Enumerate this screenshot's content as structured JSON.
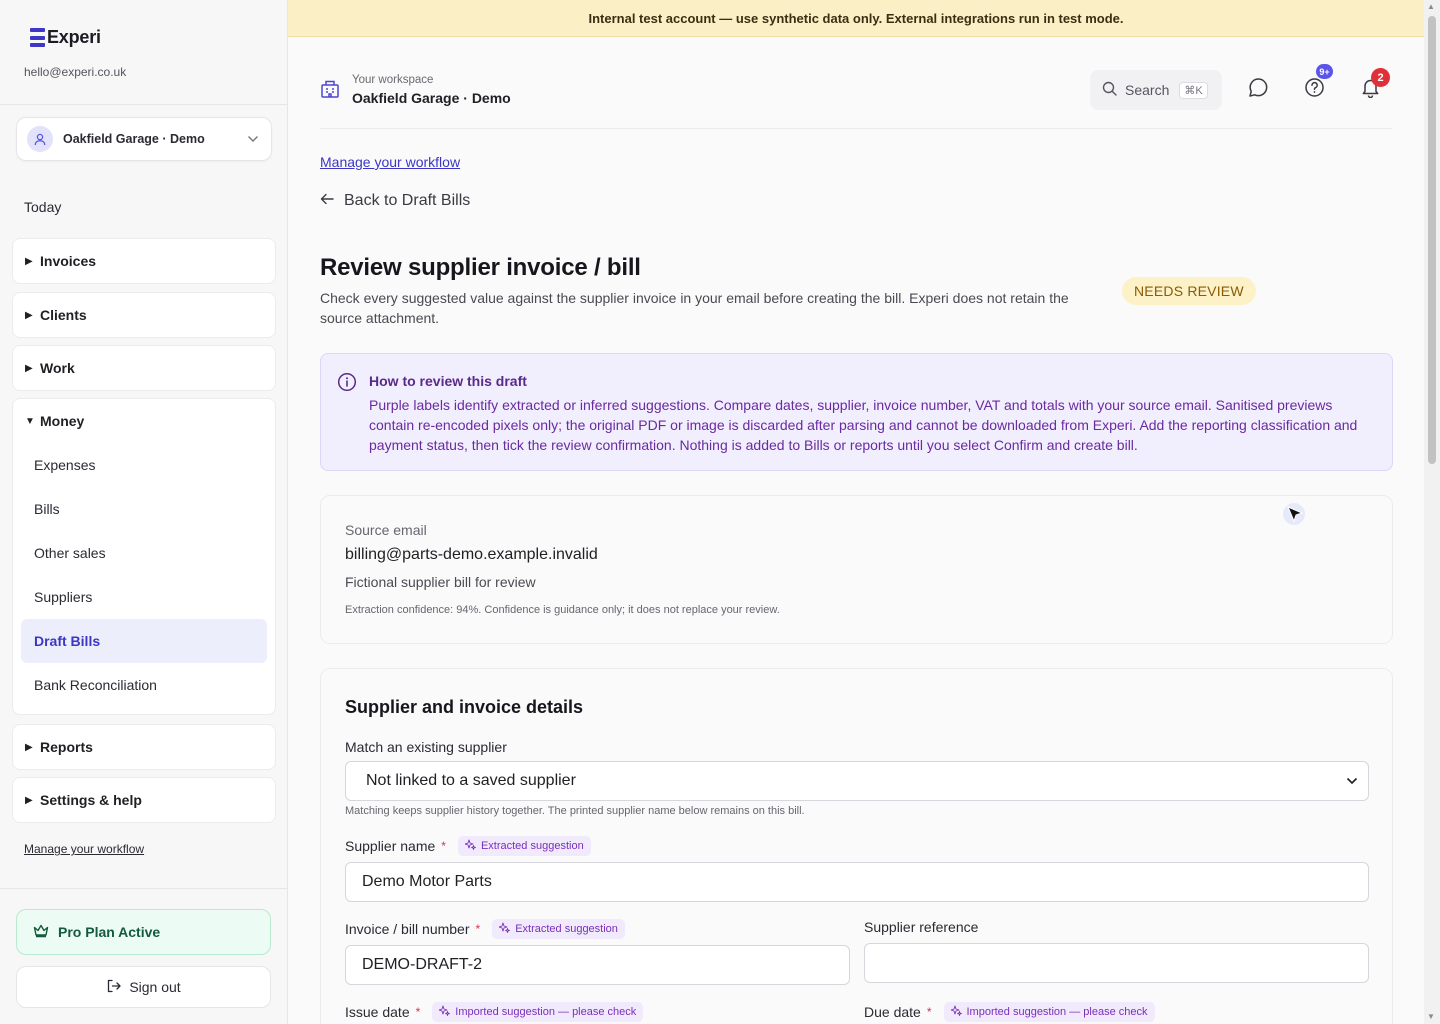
{
  "app": {
    "brand": "Experi",
    "account_email": "hello@experi.co.uk",
    "banner": "Internal test account — use synthetic data only. External integrations run in test mode."
  },
  "sidebar": {
    "workspace_select": "Oakfield Garage · Demo",
    "today": "Today",
    "groups": [
      {
        "label": "Invoices",
        "expanded": false
      },
      {
        "label": "Clients",
        "expanded": false
      },
      {
        "label": "Work",
        "expanded": false
      },
      {
        "label": "Money",
        "expanded": true,
        "items": [
          "Expenses",
          "Bills",
          "Other sales",
          "Suppliers",
          "Draft Bills",
          "Bank Reconciliation"
        ],
        "active": "Draft Bills"
      },
      {
        "label": "Reports",
        "expanded": false
      },
      {
        "label": "Settings & help",
        "expanded": false
      }
    ],
    "manage_link": "Manage your workflow",
    "plan": "Pro Plan Active",
    "sign_out": "Sign out"
  },
  "topbar": {
    "workspace_caption": "Your workspace",
    "workspace_name": "Oakfield Garage · Demo",
    "search_label": "Search",
    "search_shortcut": "⌘K",
    "help_badge": "9+",
    "notification_badge": "2"
  },
  "page": {
    "manage_link": "Manage your workflow",
    "back_link": "Back to Draft Bills",
    "title": "Review supplier invoice / bill",
    "description": "Check every suggested value against the supplier invoice in your email before creating the bill. Experi does not retain the source attachment.",
    "status": "NEEDS REVIEW"
  },
  "info": {
    "title": "How to review this draft",
    "text": "Purple labels identify extracted or inferred suggestions. Compare dates, supplier, invoice number, VAT and totals with your source email. Sanitised previews contain re-encoded pixels only; the original PDF or image is discarded after parsing and cannot be downloaded from Experi. Add the reporting classification and payment status, then tick the review confirmation. Nothing is added to Bills or reports until you select Confirm and create bill."
  },
  "source": {
    "label": "Source email",
    "email": "billing@parts-demo.example.invalid",
    "description": "Fictional supplier bill for review",
    "confidence": "Extraction confidence: 94%. Confidence is guidance only; it does not replace your review."
  },
  "details": {
    "title": "Supplier and invoice details",
    "match_label": "Match an existing supplier",
    "match_value": "Not linked to a saved supplier",
    "match_help": "Matching keeps supplier history together. The printed supplier name below remains on this bill.",
    "supplier_name_label": "Supplier name",
    "supplier_name_value": "Demo Motor Parts",
    "invoice_number_label": "Invoice / bill number",
    "invoice_number_value": "DEMO-DRAFT-2",
    "supplier_ref_label": "Supplier reference",
    "supplier_ref_value": "",
    "issue_date_label": "Issue date",
    "due_date_label": "Due date",
    "required_mark": "*",
    "extracted_tag": "Extracted suggestion",
    "imported_tag": "Imported suggestion — please check"
  },
  "colors": {
    "accent": "#3b36c4",
    "banner_bg": "#fbf0c5",
    "info_bg": "#f1eefe",
    "suggestion_purple": "#7a2fb8",
    "needs_review_bg": "#fdf1c7",
    "plan_bg": "#ecfbf3",
    "notification_red": "#e12f3a"
  },
  "icons": [
    "logo-icon",
    "user-icon",
    "chevron-down-icon",
    "triangle-right-icon",
    "triangle-down-icon",
    "crown-icon",
    "sign-out-icon",
    "building-icon",
    "search-icon",
    "chat-icon",
    "help-icon",
    "bell-icon",
    "arrow-left-icon",
    "info-icon",
    "sparkle-icon",
    "cursor-icon"
  ]
}
